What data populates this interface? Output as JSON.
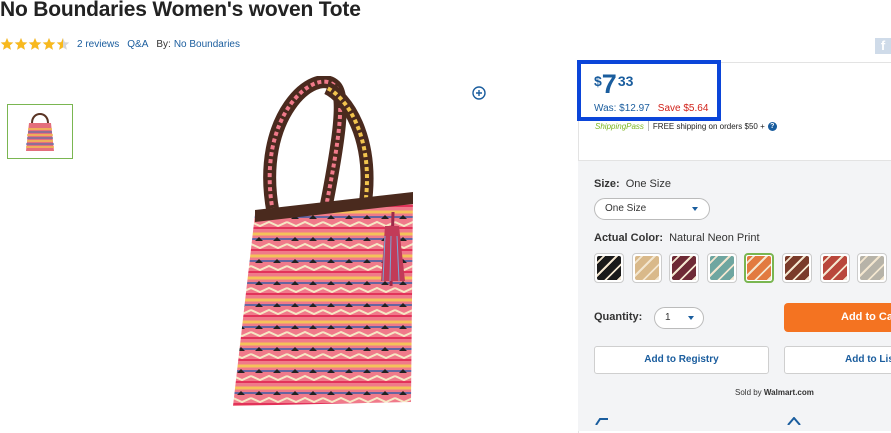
{
  "product": {
    "title": "No Boundaries Women's woven Tote",
    "rating": 4.5,
    "rating_max": 5,
    "reviews_link": "2 reviews",
    "qa_link": "Q&A",
    "by_label": "By:",
    "brand_link": "No Boundaries"
  },
  "social": {
    "share_icon": "facebook-icon",
    "share_glyph": "f"
  },
  "price": {
    "currency": "$",
    "whole": "7",
    "cents": "33",
    "was": "Was: $12.97",
    "save": "Save $5.64"
  },
  "shipping": {
    "pass": "ShippingPass",
    "free": "FREE shipping on orders $50 +",
    "help_glyph": "?"
  },
  "options": {
    "size_label": "Size:",
    "size_value": "One Size",
    "size_selected": "One Size",
    "color_label": "Actual Color:",
    "color_value": "Natural Neon Print",
    "swatches": [
      {
        "name": "black-white-print",
        "color": "#1a1a1a"
      },
      {
        "name": "tan-stripe",
        "color": "#d9b98a"
      },
      {
        "name": "burgundy-print",
        "color": "#6e2a35"
      },
      {
        "name": "teal-print",
        "color": "#6fa6a0"
      },
      {
        "name": "natural-neon-print",
        "color": "#e27a3f"
      },
      {
        "name": "brown-stripe",
        "color": "#7a3b2a"
      },
      {
        "name": "red-tribal",
        "color": "#b9473b"
      },
      {
        "name": "grey-ikat",
        "color": "#b7b3a8"
      }
    ],
    "selected_swatch": 4
  },
  "purchase": {
    "qty_label": "Quantity:",
    "qty_value": "1",
    "add_to_cart": "Add to Ca",
    "add_to_registry": "Add to Registry",
    "add_to_list": "Add to Lis",
    "sold_prefix": "Sold by",
    "seller": "Walmart.com"
  },
  "colors": {
    "link": "#1a5d9e",
    "accent_orange": "#f47321",
    "save_red": "#d1221a",
    "highlight_box": "#0b45d9",
    "star": "#f8b91d",
    "selected_border": "#7ab651"
  }
}
